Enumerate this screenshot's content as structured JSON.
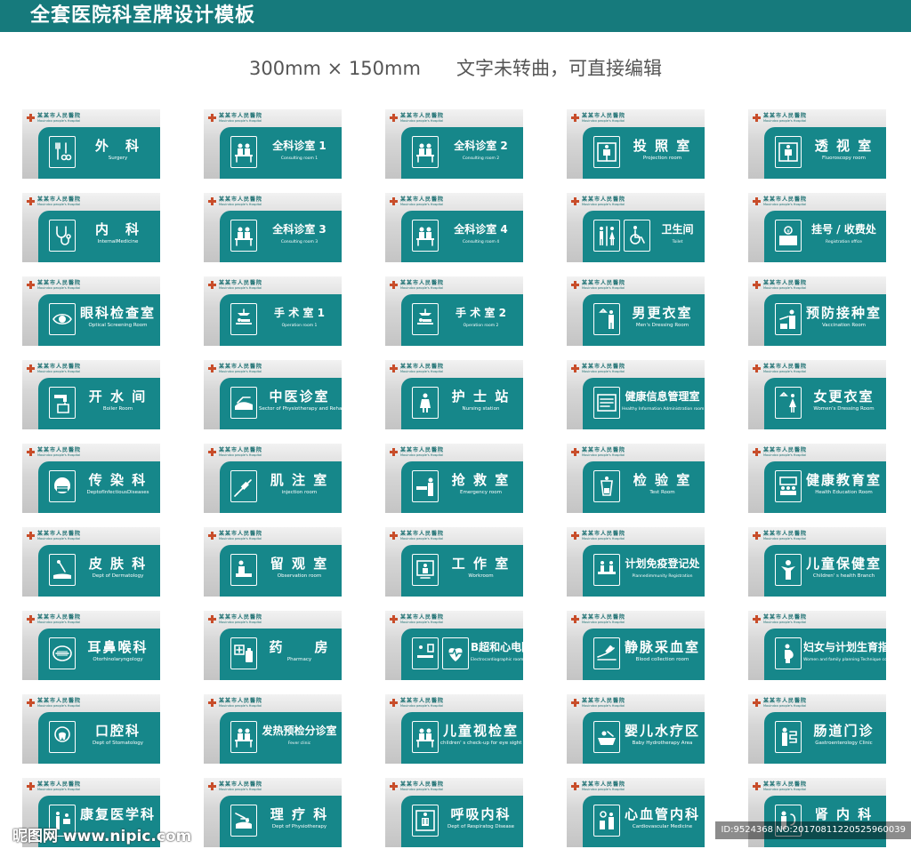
{
  "header": {
    "title": "全套医院科室牌设计模板",
    "subtitle": "300mm × 150mm      文字未转曲，可直接编辑"
  },
  "colors": {
    "teal": "#16878a",
    "bar": "#167a7c",
    "silver": "#d0d0d0",
    "logo": "#c84d2a"
  },
  "hospital": {
    "name": "某某市人民醫院",
    "sub": "Mouindxx people's Hospital"
  },
  "signs": [
    {
      "zh": "外　科",
      "en": "Surgery",
      "icon": "surgery-tools-icon"
    },
    {
      "zh": "全科诊室 1",
      "en": "Consulting room 1",
      "icon": "doctor-desk-icon"
    },
    {
      "zh": "全科诊室 2",
      "en": "Consulting room 2",
      "icon": "doctor-desk-icon"
    },
    {
      "zh": "投 照 室",
      "en": "Projection room",
      "icon": "xray-icon"
    },
    {
      "zh": "透 视 室",
      "en": "Fluoroscopy room",
      "icon": "xray-icon"
    },
    {
      "zh": "内　科",
      "en": "InternalMedicine",
      "icon": "stethoscope-icon"
    },
    {
      "zh": "全科诊室 3",
      "en": "Consulting room 3",
      "icon": "doctor-desk-icon"
    },
    {
      "zh": "全科诊室 4",
      "en": "Consulting room 4",
      "icon": "doctor-desk-icon"
    },
    {
      "zh": "卫生间",
      "en": "Toilet",
      "icon": "toilet-icon",
      "icon2": "wheelchair-icon"
    },
    {
      "zh": "挂号 / 收费处",
      "en": "Registration office",
      "icon": "registration-icon"
    },
    {
      "zh": "眼科检查室",
      "en": "Optical Screening Room",
      "icon": "eye-icon"
    },
    {
      "zh": "手 术 室 1",
      "en": "Operation room 1",
      "icon": "operation-lamp-icon"
    },
    {
      "zh": "手 术 室 2",
      "en": "Operation room 2",
      "icon": "operation-lamp-icon"
    },
    {
      "zh": "男更衣室",
      "en": "Men's Dressing Room",
      "icon": "man-dressing-icon"
    },
    {
      "zh": "预防接种室",
      "en": "Vaccination Room",
      "icon": "vaccination-icon"
    },
    {
      "zh": "开 水 间",
      "en": "Boiler Room",
      "icon": "water-tap-icon"
    },
    {
      "zh": "中医诊室",
      "en": "Sector of Physiotherapy and Rehabilitation Room",
      "icon": "pulse-hand-icon"
    },
    {
      "zh": "护 士 站",
      "en": "Nursing station",
      "icon": "nurse-icon"
    },
    {
      "zh": "健康信息管理室",
      "en": "Healthy Information Administration room",
      "icon": "records-icon"
    },
    {
      "zh": "女更衣室",
      "en": "Women's Dressing Room",
      "icon": "woman-dressing-icon"
    },
    {
      "zh": "传 染 科",
      "en": "DeptofInfectiousDiseases",
      "icon": "mask-icon"
    },
    {
      "zh": "肌 注 室",
      "en": "injection room",
      "icon": "syringe-icon"
    },
    {
      "zh": "抢 救 室",
      "en": "Emergency room",
      "icon": "emergency-icon"
    },
    {
      "zh": "检 验 室",
      "en": "Test Room",
      "icon": "lab-test-icon"
    },
    {
      "zh": "健康教育室",
      "en": "Health Education Room",
      "icon": "education-icon"
    },
    {
      "zh": "皮 肤 科",
      "en": "Dept of Dermatology",
      "icon": "skin-icon"
    },
    {
      "zh": "留 观 室",
      "en": "Observation room",
      "icon": "observation-icon"
    },
    {
      "zh": "工 作 室",
      "en": "Workroom",
      "icon": "workroom-icon"
    },
    {
      "zh": "计划免疫登记处",
      "en": "Plannedimmunity Registration",
      "icon": "immunity-desk-icon"
    },
    {
      "zh": "儿童保健室",
      "en": "Children' s health Branch",
      "icon": "child-icon"
    },
    {
      "zh": "耳鼻喉科",
      "en": "Otorhinolaryngology",
      "icon": "mouth-icon"
    },
    {
      "zh": "药　　房",
      "en": "Pharmacy",
      "icon": "pharmacy-icon"
    },
    {
      "zh": "B超和心电图室",
      "en": "Electrocardiographic room",
      "icon": "ultrasound-icon",
      "icon2": "heart-ecg-icon"
    },
    {
      "zh": "静脉采血室",
      "en": "Blood collection room",
      "icon": "blood-draw-icon"
    },
    {
      "zh": "妇女与计划生育指导室",
      "en": "Women and family planning Technique consultation office",
      "icon": "pregnant-icon"
    },
    {
      "zh": "口腔科",
      "en": "Dept of Stomatology",
      "icon": "dental-icon"
    },
    {
      "zh": "发热预检分诊室",
      "en": "Fever clinic",
      "icon": "doctor-desk-icon"
    },
    {
      "zh": "儿童视检室",
      "en": "children' s check-up for eye sight",
      "icon": "doctor-desk-icon"
    },
    {
      "zh": "婴儿水疗区",
      "en": "Baby Hydrotherapy Area",
      "icon": "baby-bath-icon"
    },
    {
      "zh": "肠道门诊",
      "en": "Gastroenterology Clinic",
      "icon": "intestine-icon"
    },
    {
      "zh": "康复医学科",
      "en": "",
      "icon": "rehab-icon"
    },
    {
      "zh": "理 疗 科",
      "en": "Dept of Physiotherapy",
      "icon": "physio-icon"
    },
    {
      "zh": "呼吸内科",
      "en": "Dept of Respiratog Disease",
      "icon": "lungs-icon"
    },
    {
      "zh": "心血管内科",
      "en": "Cardiovascular Medicine",
      "icon": "cardio-icon"
    },
    {
      "zh": "肾 内 科",
      "en": "",
      "icon": "kidney-icon"
    }
  ],
  "watermark": {
    "left": "昵图网 www.nipic.com",
    "right": "ID:9524368 NO:20170811220525960039"
  }
}
